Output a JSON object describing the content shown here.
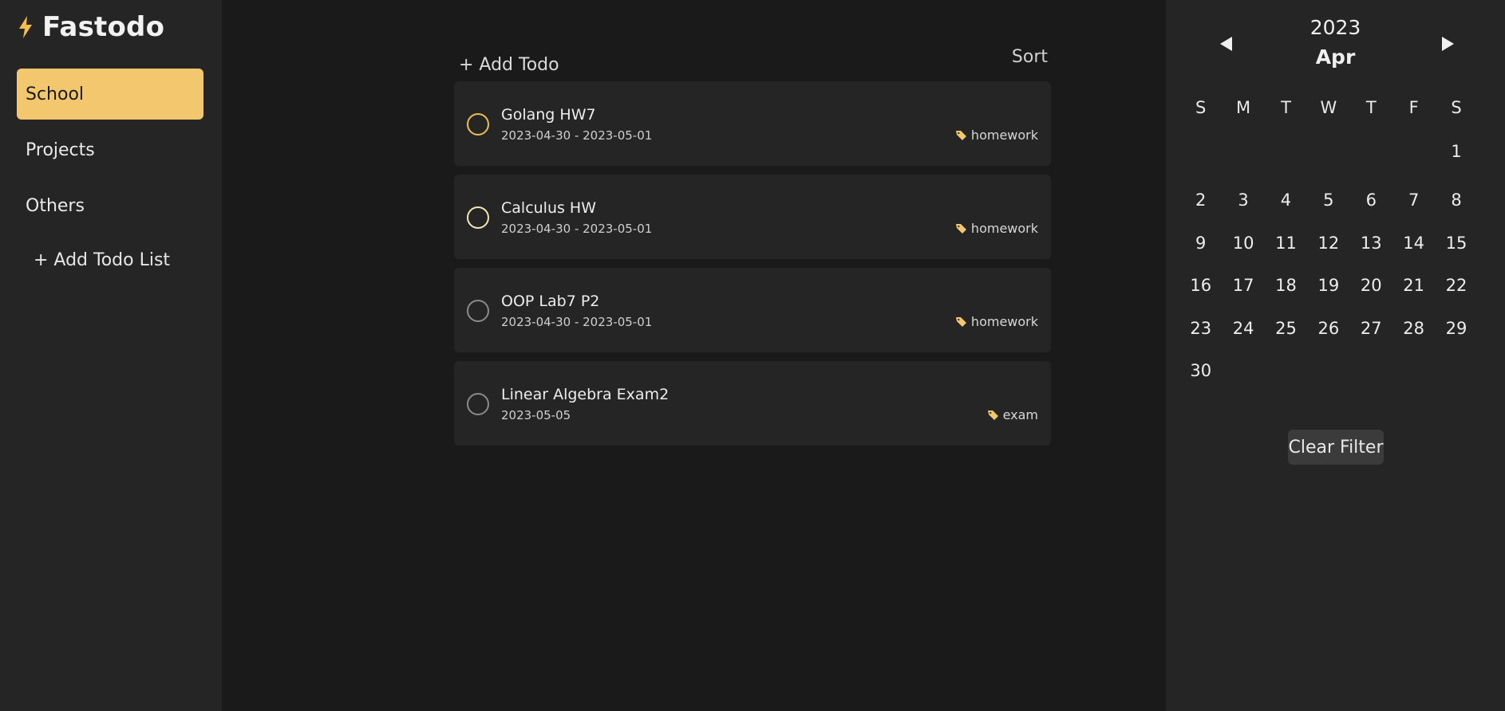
{
  "app": {
    "title": "Fastodo",
    "brand_icon": "lightning-icon",
    "accent": "#f2c76d"
  },
  "sidebar": {
    "items": [
      {
        "label": "School",
        "active": true
      },
      {
        "label": "Projects",
        "active": false
      },
      {
        "label": "Others",
        "active": false
      }
    ],
    "add_list_label": "+ Add Todo List"
  },
  "main": {
    "add_todo_label": "+ Add Todo",
    "sort_label": "Sort",
    "todos": [
      {
        "title": "Golang HW7",
        "date": "2023-04-30 - 2023-05-01",
        "tag": "homework",
        "check_color": "#e8c04f"
      },
      {
        "title": "Calculus HW",
        "date": "2023-04-30 - 2023-05-01",
        "tag": "homework",
        "check_color": "#f5e6b4"
      },
      {
        "title": "OOP Lab7 P2",
        "date": "2023-04-30 - 2023-05-01",
        "tag": "homework",
        "check_color": "#8a8a8a"
      },
      {
        "title": "Linear Algebra Exam2",
        "date": "2023-05-05",
        "tag": "exam",
        "check_color": "#8a8a8a"
      }
    ]
  },
  "calendar": {
    "year": "2023",
    "month": "Apr",
    "weekdays": [
      "S",
      "M",
      "T",
      "W",
      "T",
      "F",
      "S"
    ],
    "weeks": [
      [
        "",
        "",
        "",
        "",
        "",
        "",
        "1"
      ],
      [
        "2",
        "3",
        "4",
        "5",
        "6",
        "7",
        "8"
      ],
      [
        "9",
        "10",
        "11",
        "12",
        "13",
        "14",
        "15"
      ],
      [
        "16",
        "17",
        "18",
        "19",
        "20",
        "21",
        "22"
      ],
      [
        "23",
        "24",
        "25",
        "26",
        "27",
        "28",
        "29"
      ],
      [
        "30",
        "",
        "",
        "",
        "",
        "",
        ""
      ]
    ],
    "clear_filter_label": "Clear Filter"
  }
}
